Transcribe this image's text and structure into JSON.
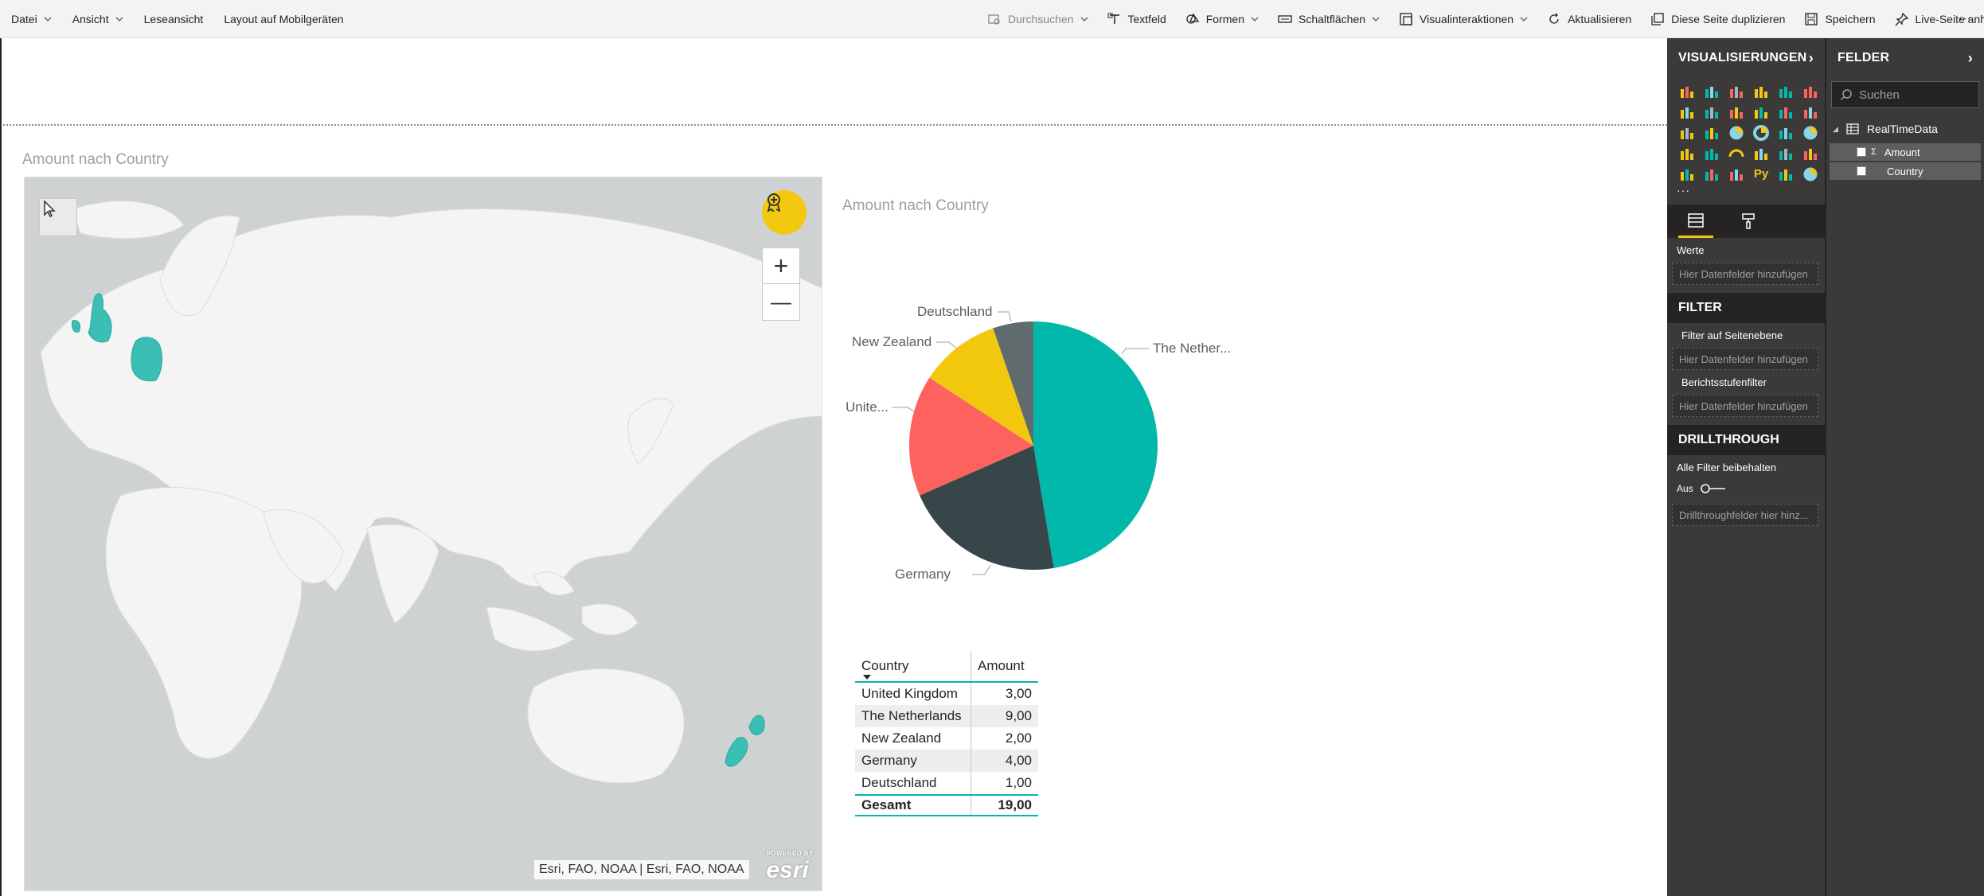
{
  "toolbar": {
    "left": [
      "Datei",
      "Ansicht",
      "Leseansicht",
      "Layout auf Mobilgeräten"
    ],
    "right": [
      {
        "label": "Durchsuchen",
        "icon": "explore-icon"
      },
      {
        "label": "Textfeld",
        "icon": "textbox-icon"
      },
      {
        "label": "Formen",
        "icon": "shapes-icon"
      },
      {
        "label": "Schaltflächen",
        "icon": "buttons-icon"
      },
      {
        "label": "Visualinteraktionen",
        "icon": "visual-interactions-icon"
      },
      {
        "label": "Aktualisieren",
        "icon": "refresh-icon"
      },
      {
        "label": "Diese Seite duplizieren",
        "icon": "duplicate-page-icon"
      },
      {
        "label": "Speichern",
        "icon": "save-icon"
      },
      {
        "label": "Live-Seite anheften",
        "icon": "pin-icon"
      }
    ],
    "more": "···"
  },
  "map_visual": {
    "title": "Amount nach Country",
    "attribution": "Esri, FAO, NOAA | Esri, FAO, NOAA",
    "esri_small": "POWERED BY",
    "esri_logo": "esri",
    "zoom_in": "+",
    "zoom_out": "—",
    "highlight_color": "#3bbfb5"
  },
  "pie_visual": {
    "title": "Amount nach Country",
    "labels": {
      "netherlands": "The Nether...",
      "germany": "Germany",
      "uk": "Unite...",
      "newzealand": "New Zealand",
      "deutschland": "Deutschland"
    }
  },
  "chart_data": {
    "type": "pie",
    "title": "Amount nach Country",
    "categories": [
      "The Netherlands",
      "Germany",
      "United Kingdom",
      "New Zealand",
      "Deutschland"
    ],
    "values": [
      9,
      4,
      3,
      2,
      1
    ],
    "colors": [
      "#01b8aa",
      "#374649",
      "#fd625e",
      "#f2c80f",
      "#5f6b6d"
    ]
  },
  "table_visual": {
    "headers": [
      "Country",
      "Amount"
    ],
    "rows": [
      [
        "United Kingdom",
        "3,00"
      ],
      [
        "The Netherlands",
        "9,00"
      ],
      [
        "New Zealand",
        "2,00"
      ],
      [
        "Germany",
        "4,00"
      ],
      [
        "Deutschland",
        "1,00"
      ]
    ],
    "total": [
      "Gesamt",
      "19,00"
    ]
  },
  "viz_pane": {
    "title": "VISUALISIERUNGEN",
    "more": "···",
    "values_label": "Werte",
    "values_drop": "Hier Datenfelder hinzufügen",
    "filter_head": "FILTER",
    "page_filter": "Filter auf Seitenebene",
    "page_filter_drop": "Hier Datenfelder hinzufügen",
    "report_filter": "Berichtsstufenfilter",
    "report_filter_drop": "Hier Datenfelder hinzufügen",
    "drill_head": "DRILLTHROUGH",
    "keep_filters": "Alle Filter beibehalten",
    "toggle_label": "Aus",
    "drill_drop": "Drillthroughfelder hier hinz..."
  },
  "fields_pane": {
    "title": "FELDER",
    "search_placeholder": "Suchen",
    "table_name": "RealTimeData",
    "fields": [
      "Amount",
      "Country"
    ],
    "sigma": "Σ"
  }
}
